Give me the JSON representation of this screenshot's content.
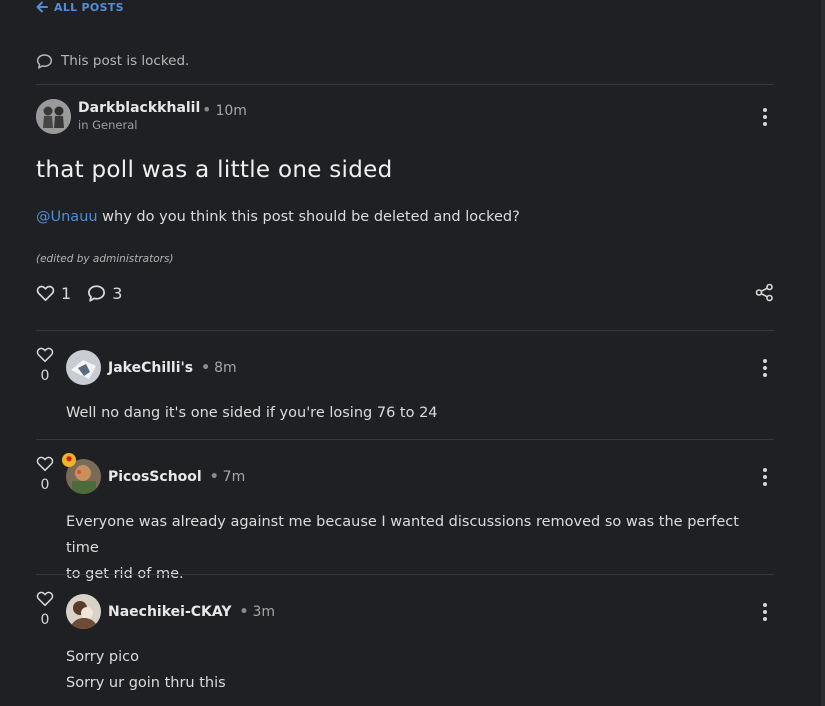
{
  "nav": {
    "back_label": "ALL POSTS"
  },
  "status": {
    "locked_text": "This post is locked."
  },
  "post": {
    "author": "Darkblackkhalil",
    "separator": "•",
    "time": "10m",
    "category_prefix": "in",
    "category": "General",
    "title": "that poll was a little one sided",
    "mention": "@Unauu",
    "body": " why do you think this post should be deleted and locked?",
    "edited_note": "(edited by administrators)",
    "likes": "1",
    "comments": "3"
  },
  "replies": [
    {
      "author": "JakeChilli's",
      "time": "8m",
      "likes": "0",
      "lines": [
        "Well no dang it's one sided if you're losing 76 to 24"
      ]
    },
    {
      "author": "PicosSchool",
      "time": "7m",
      "likes": "0",
      "has_badge": true,
      "lines": [
        "Everyone was already against me because I wanted discussions removed so was the perfect time",
        "to get rid of me."
      ]
    },
    {
      "author": "Naechikei-CKAY",
      "time": "3m",
      "likes": "0",
      "lines": [
        "Sorry pico",
        "Sorry ur goin thru this"
      ]
    }
  ],
  "icons": {
    "back": "arrow-left-icon",
    "locked": "comment-bubble-icon",
    "like": "heart-icon",
    "comment": "comment-bubble-icon",
    "share": "share-icon",
    "menu": "kebab-menu-icon"
  },
  "colors": {
    "background": "#1e2023",
    "accent_link": "#4f8fd8",
    "divider": "#34373c",
    "text": "#e4e4e4"
  }
}
